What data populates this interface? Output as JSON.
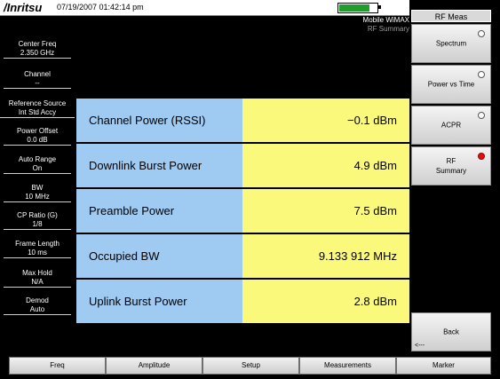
{
  "header": {
    "logo": "/Inritsu",
    "datetime": "07/19/2007 01:42:14 pm",
    "battery_level": 0.8,
    "battery_color": "#1f9e2b"
  },
  "mode": {
    "standard": "Mobile WiMAX",
    "view": "RF Summary"
  },
  "left_params": [
    {
      "label": "Center Freq",
      "value": "2.350 GHz"
    },
    {
      "label": "Channel",
      "value": "--"
    },
    {
      "label": "Reference Source",
      "value": "Int Std Accy"
    },
    {
      "label": "Power Offset",
      "value": "0.0 dB"
    },
    {
      "label": "Auto Range",
      "value": "On"
    },
    {
      "label": "BW",
      "value": "10 MHz"
    },
    {
      "label": "CP Ratio (G)",
      "value": "1/8"
    },
    {
      "label": "Frame Length",
      "value": "10 ms"
    },
    {
      "label": "Max Hold",
      "value": "N/A"
    },
    {
      "label": "Demod",
      "value": "Auto"
    }
  ],
  "measurements": [
    {
      "name": "Channel Power (RSSI)",
      "value": "−0.1 dBm"
    },
    {
      "name": "Downlink Burst Power",
      "value": "4.9 dBm"
    },
    {
      "name": "Preamble Power",
      "value": "7.5 dBm"
    },
    {
      "name": "Occupied BW",
      "value": "9.133 912 MHz"
    },
    {
      "name": "Uplink Burst Power",
      "value": "2.8 dBm"
    }
  ],
  "right_menu": {
    "title": "RF Meas",
    "keys": [
      {
        "label": "Spectrum",
        "selected": false
      },
      {
        "label": "Power vs Time",
        "selected": false
      },
      {
        "label": "ACPR",
        "selected": false
      },
      {
        "label": "RF\nSummary",
        "selected": true
      }
    ],
    "back_label": "Back",
    "back_sub": "<---"
  },
  "bottom_menu": [
    "Freq",
    "Amplitude",
    "Setup",
    "Measurements",
    "Marker"
  ],
  "colors": {
    "label_cell": "#9fcaf2",
    "value_cell": "#fbf97c",
    "selected_indicator": "#e0101a"
  }
}
